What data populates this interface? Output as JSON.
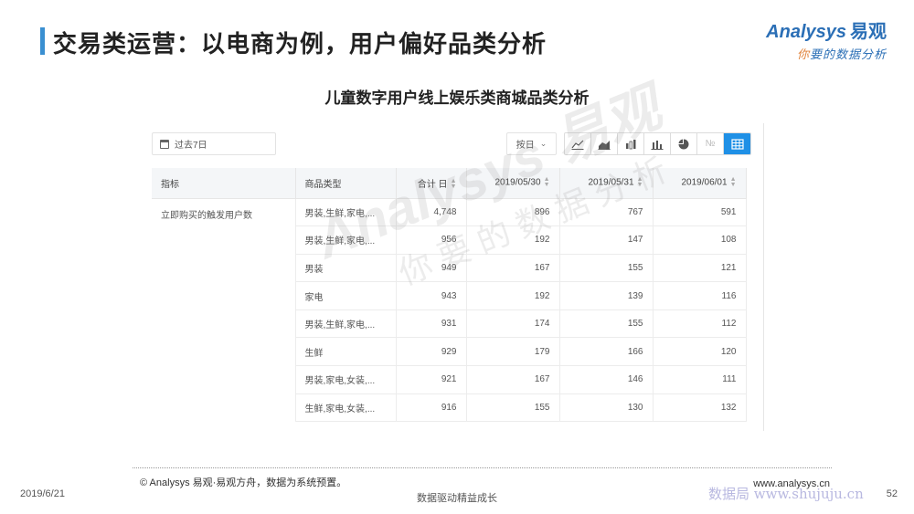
{
  "slide": {
    "title": "交易类运营：以电商为例，用户偏好品类分析",
    "chart_title": "儿童数字用户线上娱乐类商城品类分析"
  },
  "brand": {
    "name": "Analysys",
    "name_cn": "易观",
    "tagline_lead": "你",
    "tagline_rest": "要的数据分析",
    "colors": {
      "primary": "#2b6fb6",
      "accent": "#e0823a"
    }
  },
  "panel": {
    "date_range": "过去7日",
    "granularity": "按日",
    "toolbar": [
      {
        "icon": "line-chart-icon",
        "active": false
      },
      {
        "icon": "area-chart-icon",
        "active": false
      },
      {
        "icon": "stacked-bar-icon",
        "active": false
      },
      {
        "icon": "bar-chart-icon",
        "active": false
      },
      {
        "icon": "pie-chart-icon",
        "active": false
      },
      {
        "icon": "number-icon",
        "label": "№",
        "active": false
      },
      {
        "icon": "table-icon",
        "active": true
      }
    ],
    "active_color": "#1f90e6"
  },
  "table": {
    "headers": [
      "指标",
      "商品类型",
      "合计 日",
      "2019/05/30",
      "2019/05/31",
      "2019/06/01"
    ],
    "metric": "立即购买的触发用户数",
    "rows": [
      {
        "category": "男装,生鲜,家电,...",
        "total": "4,748",
        "d1": "896",
        "d2": "767",
        "d3": "591"
      },
      {
        "category": "男装,生鲜,家电,...",
        "total": "956",
        "d1": "192",
        "d2": "147",
        "d3": "108"
      },
      {
        "category": "男装",
        "total": "949",
        "d1": "167",
        "d2": "155",
        "d3": "121"
      },
      {
        "category": "家电",
        "total": "943",
        "d1": "192",
        "d2": "139",
        "d3": "116"
      },
      {
        "category": "男装,生鲜,家电,...",
        "total": "931",
        "d1": "174",
        "d2": "155",
        "d3": "112"
      },
      {
        "category": "生鲜",
        "total": "929",
        "d1": "179",
        "d2": "166",
        "d3": "120"
      },
      {
        "category": "男装,家电,女装,...",
        "total": "921",
        "d1": "167",
        "d2": "146",
        "d3": "111"
      },
      {
        "category": "生鲜,家电,女装,...",
        "total": "916",
        "d1": "155",
        "d2": "130",
        "d3": "132"
      }
    ]
  },
  "watermark": {
    "main": "Analysys 易观",
    "sub": "你要的数据分析"
  },
  "footer": {
    "source": "© Analysys 易观·易观方舟，数据为系统预置。",
    "url": "www.analysys.cn",
    "date": "2019/6/21",
    "slogan": "数据驱动精益成长",
    "site_watermark": "数据局 www.shujuju.cn",
    "page": "52"
  }
}
